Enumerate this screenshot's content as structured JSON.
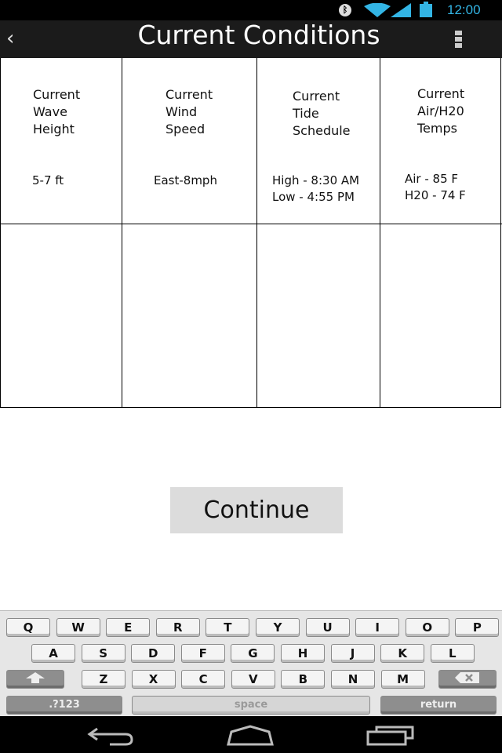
{
  "status_bar": {
    "time": "12:00",
    "icons": [
      "bluetooth-icon",
      "wifi-icon",
      "signal-icon",
      "battery-icon"
    ],
    "accent": "#33b5e5"
  },
  "app_bar": {
    "back_icon": "chevron-left-icon",
    "title": "Current Conditions",
    "menu_icon": "overflow-menu-icon"
  },
  "table": {
    "headers": [
      "Current\nWave\nHeight",
      "Current\nWind\nSpeed",
      "Current\nTide\nSchedule",
      "Current\nAir/H20\nTemps"
    ],
    "values": [
      "5-7 ft",
      "East-8mph",
      "High - 8:30 AM\nLow - 4:55 PM",
      "Air - 85 F\nH20 - 74 F"
    ]
  },
  "continue_label": "Continue",
  "keyboard": {
    "row1": [
      "Q",
      "W",
      "E",
      "R",
      "T",
      "Y",
      "U",
      "I",
      "O",
      "P"
    ],
    "row2": [
      "A",
      "S",
      "D",
      "F",
      "G",
      "H",
      "J",
      "K",
      "L"
    ],
    "row3": [
      "Z",
      "X",
      "C",
      "V",
      "B",
      "N",
      "M"
    ],
    "symbols_label": ".?123",
    "space_label": "space",
    "return_label": "return"
  },
  "nav_bar": {
    "icons": [
      "back-icon",
      "home-icon",
      "recent-apps-icon"
    ]
  }
}
